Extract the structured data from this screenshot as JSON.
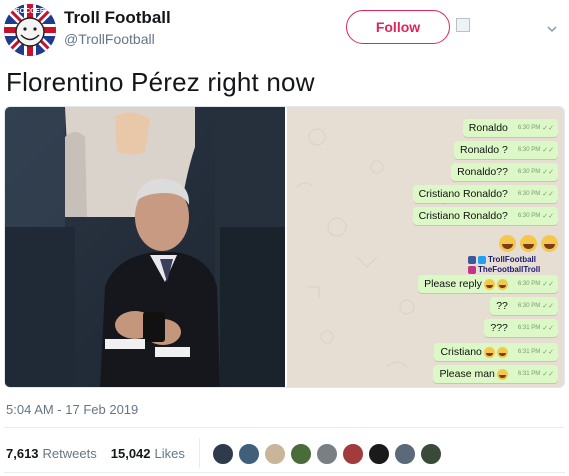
{
  "account": {
    "name": "Troll Football",
    "handle": "@TrollFootball",
    "avatar_icon": "troll-face-union-jack-avatar-icon",
    "avatar_text": "SOCCER"
  },
  "header": {
    "follow_label": "Follow"
  },
  "tweet": {
    "text": "Florentino Pérez right now",
    "timestamp": "5:04 AM - 17 Feb 2019"
  },
  "chat": {
    "messages": [
      {
        "text": "Ronaldo",
        "time": "6:30 PM",
        "emoji": 0
      },
      {
        "text": "Ronaldo ?",
        "time": "6:30 PM",
        "emoji": 0
      },
      {
        "text": "Ronaldo??",
        "time": "6:30 PM",
        "emoji": 0
      },
      {
        "text": "Cristiano Ronaldo?",
        "time": "6:30 PM",
        "emoji": 0
      },
      {
        "text": "Cristiano Ronaldo?",
        "time": "6:30 PM",
        "emoji": 0
      },
      {
        "text": "Please reply",
        "time": "6:30 PM",
        "emoji": 2
      },
      {
        "text": "??",
        "time": "6:30 PM",
        "emoji": 0
      },
      {
        "text": "???",
        "time": "6:31 PM",
        "emoji": 0
      },
      {
        "text": "Cristiano",
        "time": "6:31 PM",
        "emoji": 2
      },
      {
        "text": "Please man",
        "time": "6:31 PM",
        "emoji": 1
      }
    ],
    "watermark_line1": "TrollFootball",
    "watermark_line2": "TheFootballTroll"
  },
  "stats": {
    "retweets_count": "7,613",
    "retweets_label": "Retweets",
    "likes_count": "15,042",
    "likes_label": "Likes"
  },
  "colors": {
    "follow_accent": "#e0245e",
    "chat_bubble": "#dcf8c6",
    "chat_background": "#e6ddd3",
    "muted_text": "#657786"
  },
  "liker_avatars": [
    {
      "color": "#2f3b4c"
    },
    {
      "color": "#3f5f7a"
    },
    {
      "color": "#c9b59a"
    },
    {
      "color": "#4a6b3a"
    },
    {
      "color": "#7a7f86"
    },
    {
      "color": "#a23b3b"
    },
    {
      "color": "#1a1a1a"
    },
    {
      "color": "#5a6a7a"
    },
    {
      "color": "#3a4a3a"
    }
  ]
}
